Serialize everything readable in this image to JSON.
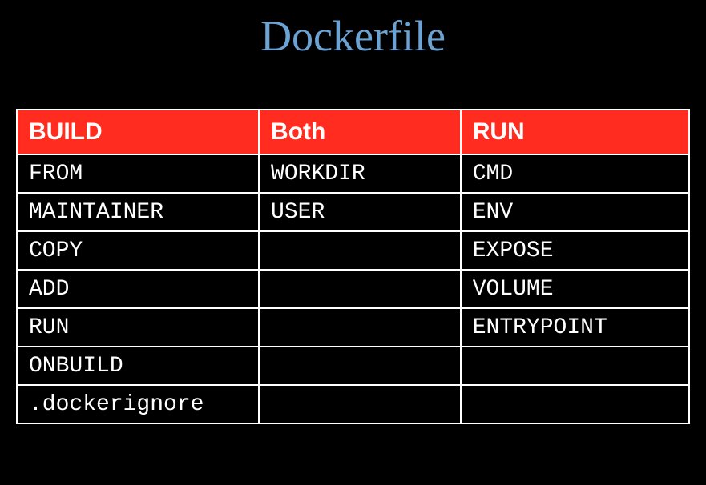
{
  "title": "Dockerfile",
  "table": {
    "headers": [
      "BUILD",
      "Both",
      "RUN"
    ],
    "rows": [
      [
        "FROM",
        "WORKDIR",
        "CMD"
      ],
      [
        "MAINTAINER",
        "USER",
        "ENV"
      ],
      [
        "COPY",
        "",
        "EXPOSE"
      ],
      [
        "ADD",
        "",
        "VOLUME"
      ],
      [
        "RUN",
        "",
        "ENTRYPOINT"
      ],
      [
        "ONBUILD",
        "",
        ""
      ],
      [
        ".dockerignore",
        "",
        ""
      ]
    ]
  }
}
